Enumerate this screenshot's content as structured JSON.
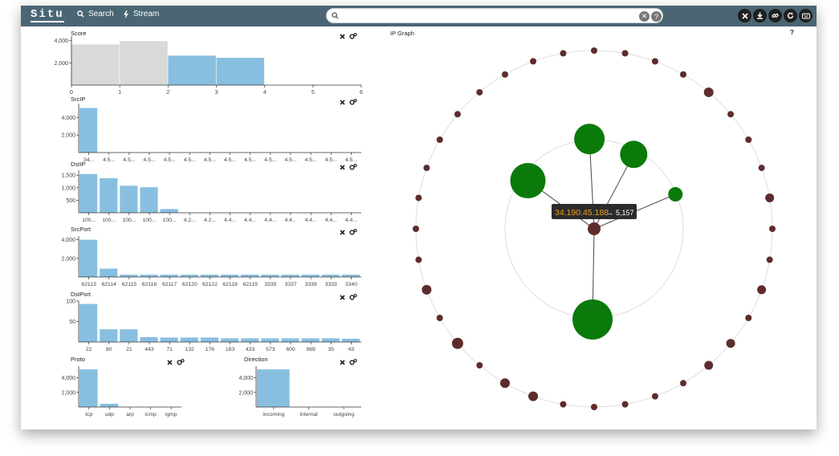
{
  "app": {
    "brand": "Situ"
  },
  "nav": {
    "search_label": "Search",
    "stream_label": "Stream"
  },
  "search": {
    "value": "",
    "placeholder": ""
  },
  "toolbar": {
    "icons": [
      "close-icon",
      "download-icon",
      "link-icon",
      "refresh-icon",
      "keyboard-icon"
    ]
  },
  "colors": {
    "topbar": "#4a6674",
    "bar": "#88bfe0",
    "bar_gray": "#d9d9d9",
    "node_small": "#5e2c2c",
    "node_big": "#0a7a0a"
  },
  "panels": {
    "score": {
      "title": "Score",
      "chart_data": {
        "type": "bar",
        "bins": [
          [
            0,
            1
          ],
          [
            1,
            2
          ],
          [
            2,
            3
          ],
          [
            3,
            4
          ]
        ],
        "values": [
          3650,
          3950,
          2650,
          2450
        ],
        "selected": [
          false,
          false,
          true,
          true
        ],
        "xticks": [
          "0",
          "1",
          "2",
          "3",
          "4",
          "5",
          "6"
        ],
        "yticks": [
          "2,000",
          "4,000"
        ],
        "xlim": [
          0,
          6
        ],
        "ylim": [
          0,
          4400
        ]
      }
    },
    "srcip": {
      "title": "SrcIP",
      "chart_data": {
        "type": "bar",
        "categories": [
          "34...",
          "4.5...",
          "4.5...",
          "4.5...",
          "4.5...",
          "4.5...",
          "4.5...",
          "4.5...",
          "4.5...",
          "4.5...",
          "4.5...",
          "4.5...",
          "4.5...",
          "4.5..."
        ],
        "values": [
          5100,
          0,
          0,
          0,
          0,
          0,
          0,
          0,
          0,
          0,
          0,
          0,
          0,
          0
        ],
        "yticks": [
          "2,000",
          "4,000"
        ],
        "ylim": [
          0,
          5600
        ]
      }
    },
    "dstip": {
      "title": "DstIP",
      "chart_data": {
        "type": "bar",
        "categories": [
          "100...",
          "100...",
          "100...",
          "100...",
          "100...",
          "4.2...",
          "4.2...",
          "4.4...",
          "4.4...",
          "4.4...",
          "4.4...",
          "4.4...",
          "4.4...",
          "4.4..."
        ],
        "values": [
          1550,
          1380,
          1080,
          1020,
          150,
          0,
          0,
          0,
          0,
          0,
          0,
          0,
          0,
          0
        ],
        "yticks": [
          "500",
          "1,000",
          "1,500"
        ],
        "ylim": [
          0,
          1700
        ]
      }
    },
    "srcport": {
      "title": "SrcPort",
      "chart_data": {
        "type": "bar",
        "categories": [
          "62113",
          "62114",
          "62115",
          "62116",
          "62117",
          "62120",
          "62122",
          "62118",
          "62119",
          "3335",
          "3337",
          "3339",
          "3333",
          "3340"
        ],
        "values": [
          4000,
          900,
          250,
          250,
          250,
          250,
          250,
          250,
          250,
          250,
          250,
          250,
          250,
          250
        ],
        "yticks": [
          "2,000",
          "4,000"
        ],
        "ylim": [
          0,
          4400
        ]
      }
    },
    "dstport": {
      "title": "DstPort",
      "chart_data": {
        "type": "bar",
        "categories": [
          "22",
          "80",
          "21",
          "443",
          "71",
          "132",
          "176",
          "183",
          "433",
          "573",
          "600",
          "989",
          "35",
          "43"
        ],
        "values": [
          93,
          31,
          31,
          12,
          11,
          11,
          11,
          9,
          9,
          9,
          9,
          9,
          9,
          8
        ],
        "yticks": [
          "50",
          "100"
        ],
        "ylim": [
          0,
          100
        ]
      }
    },
    "proto": {
      "title": "Proto",
      "chart_data": {
        "type": "bar",
        "categories": [
          "tcp",
          "udp",
          "arp",
          "icmp",
          "igmp"
        ],
        "values": [
          5150,
          450,
          0,
          0,
          0
        ],
        "yticks": [
          "2,000",
          "4,000"
        ],
        "ylim": [
          0,
          5600
        ]
      }
    },
    "direction": {
      "title": "Direction",
      "chart_data": {
        "type": "bar",
        "categories": [
          "incoming",
          "internal",
          "outgoing"
        ],
        "values": [
          5150,
          0,
          0
        ],
        "yticks": [
          "2,000",
          "4,000"
        ],
        "ylim": [
          0,
          5600
        ]
      }
    }
  },
  "ipgraph": {
    "title": "IP Graph",
    "help": "?",
    "tooltip_ip": "34.190.45.188",
    "tooltip_arrow": "→",
    "tooltip_count": "5,157",
    "tooltip_ip_color": "#f0a020"
  }
}
